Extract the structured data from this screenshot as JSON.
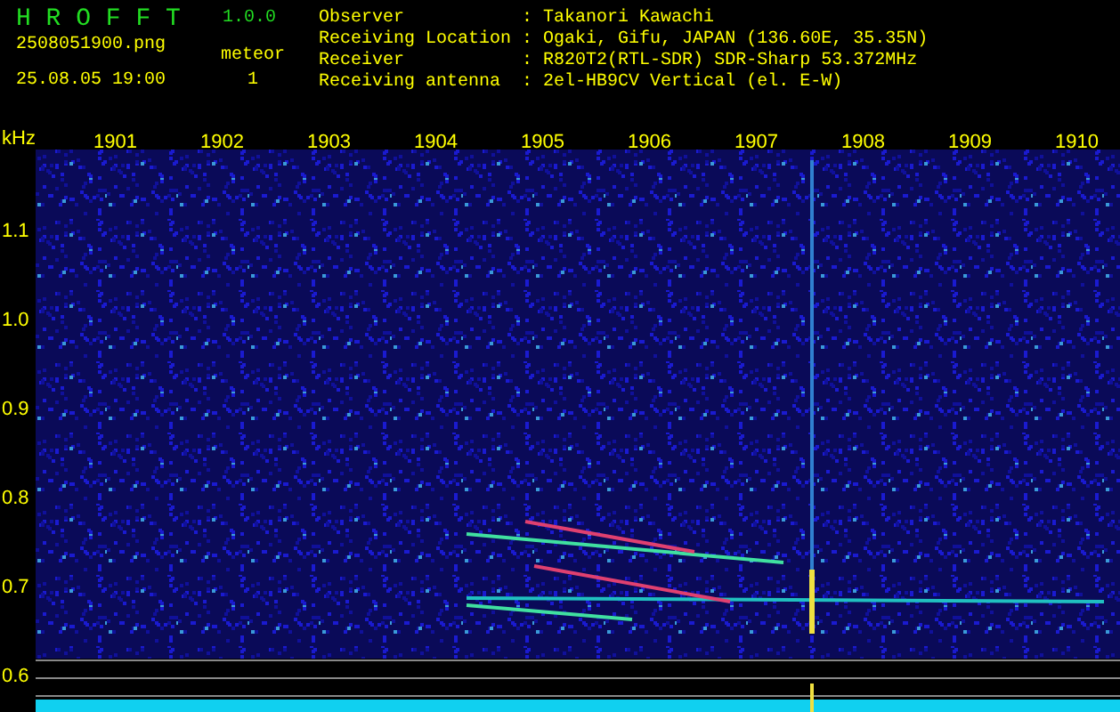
{
  "header": {
    "title": "H R O F F T",
    "version": "1.0.0",
    "filename": "2508051900.png",
    "datetime": "25.08.05 19:00",
    "meteor_label": "meteor",
    "meteor_count": "1"
  },
  "info": [
    {
      "label": "Observer",
      "separator": ":",
      "value": "Takanori Kawachi"
    },
    {
      "label": "Receiving Location",
      "separator": ":",
      "value": "Ogaki, Gifu, JAPAN (136.60E, 35.35N)"
    },
    {
      "label": "Receiver",
      "separator": ":",
      "value": "R820T2(RTL-SDR) SDR-Sharp 53.372MHz"
    },
    {
      "label": "Receiving antenna",
      "separator": ":",
      "value": "2el-HB9CV Vertical (el. E-W)"
    }
  ],
  "spectrogram": {
    "y_unit": "kHz",
    "x_ticks": [
      "1901",
      "1902",
      "1903",
      "1904",
      "1905",
      "1906",
      "1907",
      "1908",
      "1909",
      "1910"
    ],
    "y_ticks": [
      "1.1",
      "1.0",
      "0.9",
      "0.8",
      "0.7",
      "0.6"
    ]
  }
}
